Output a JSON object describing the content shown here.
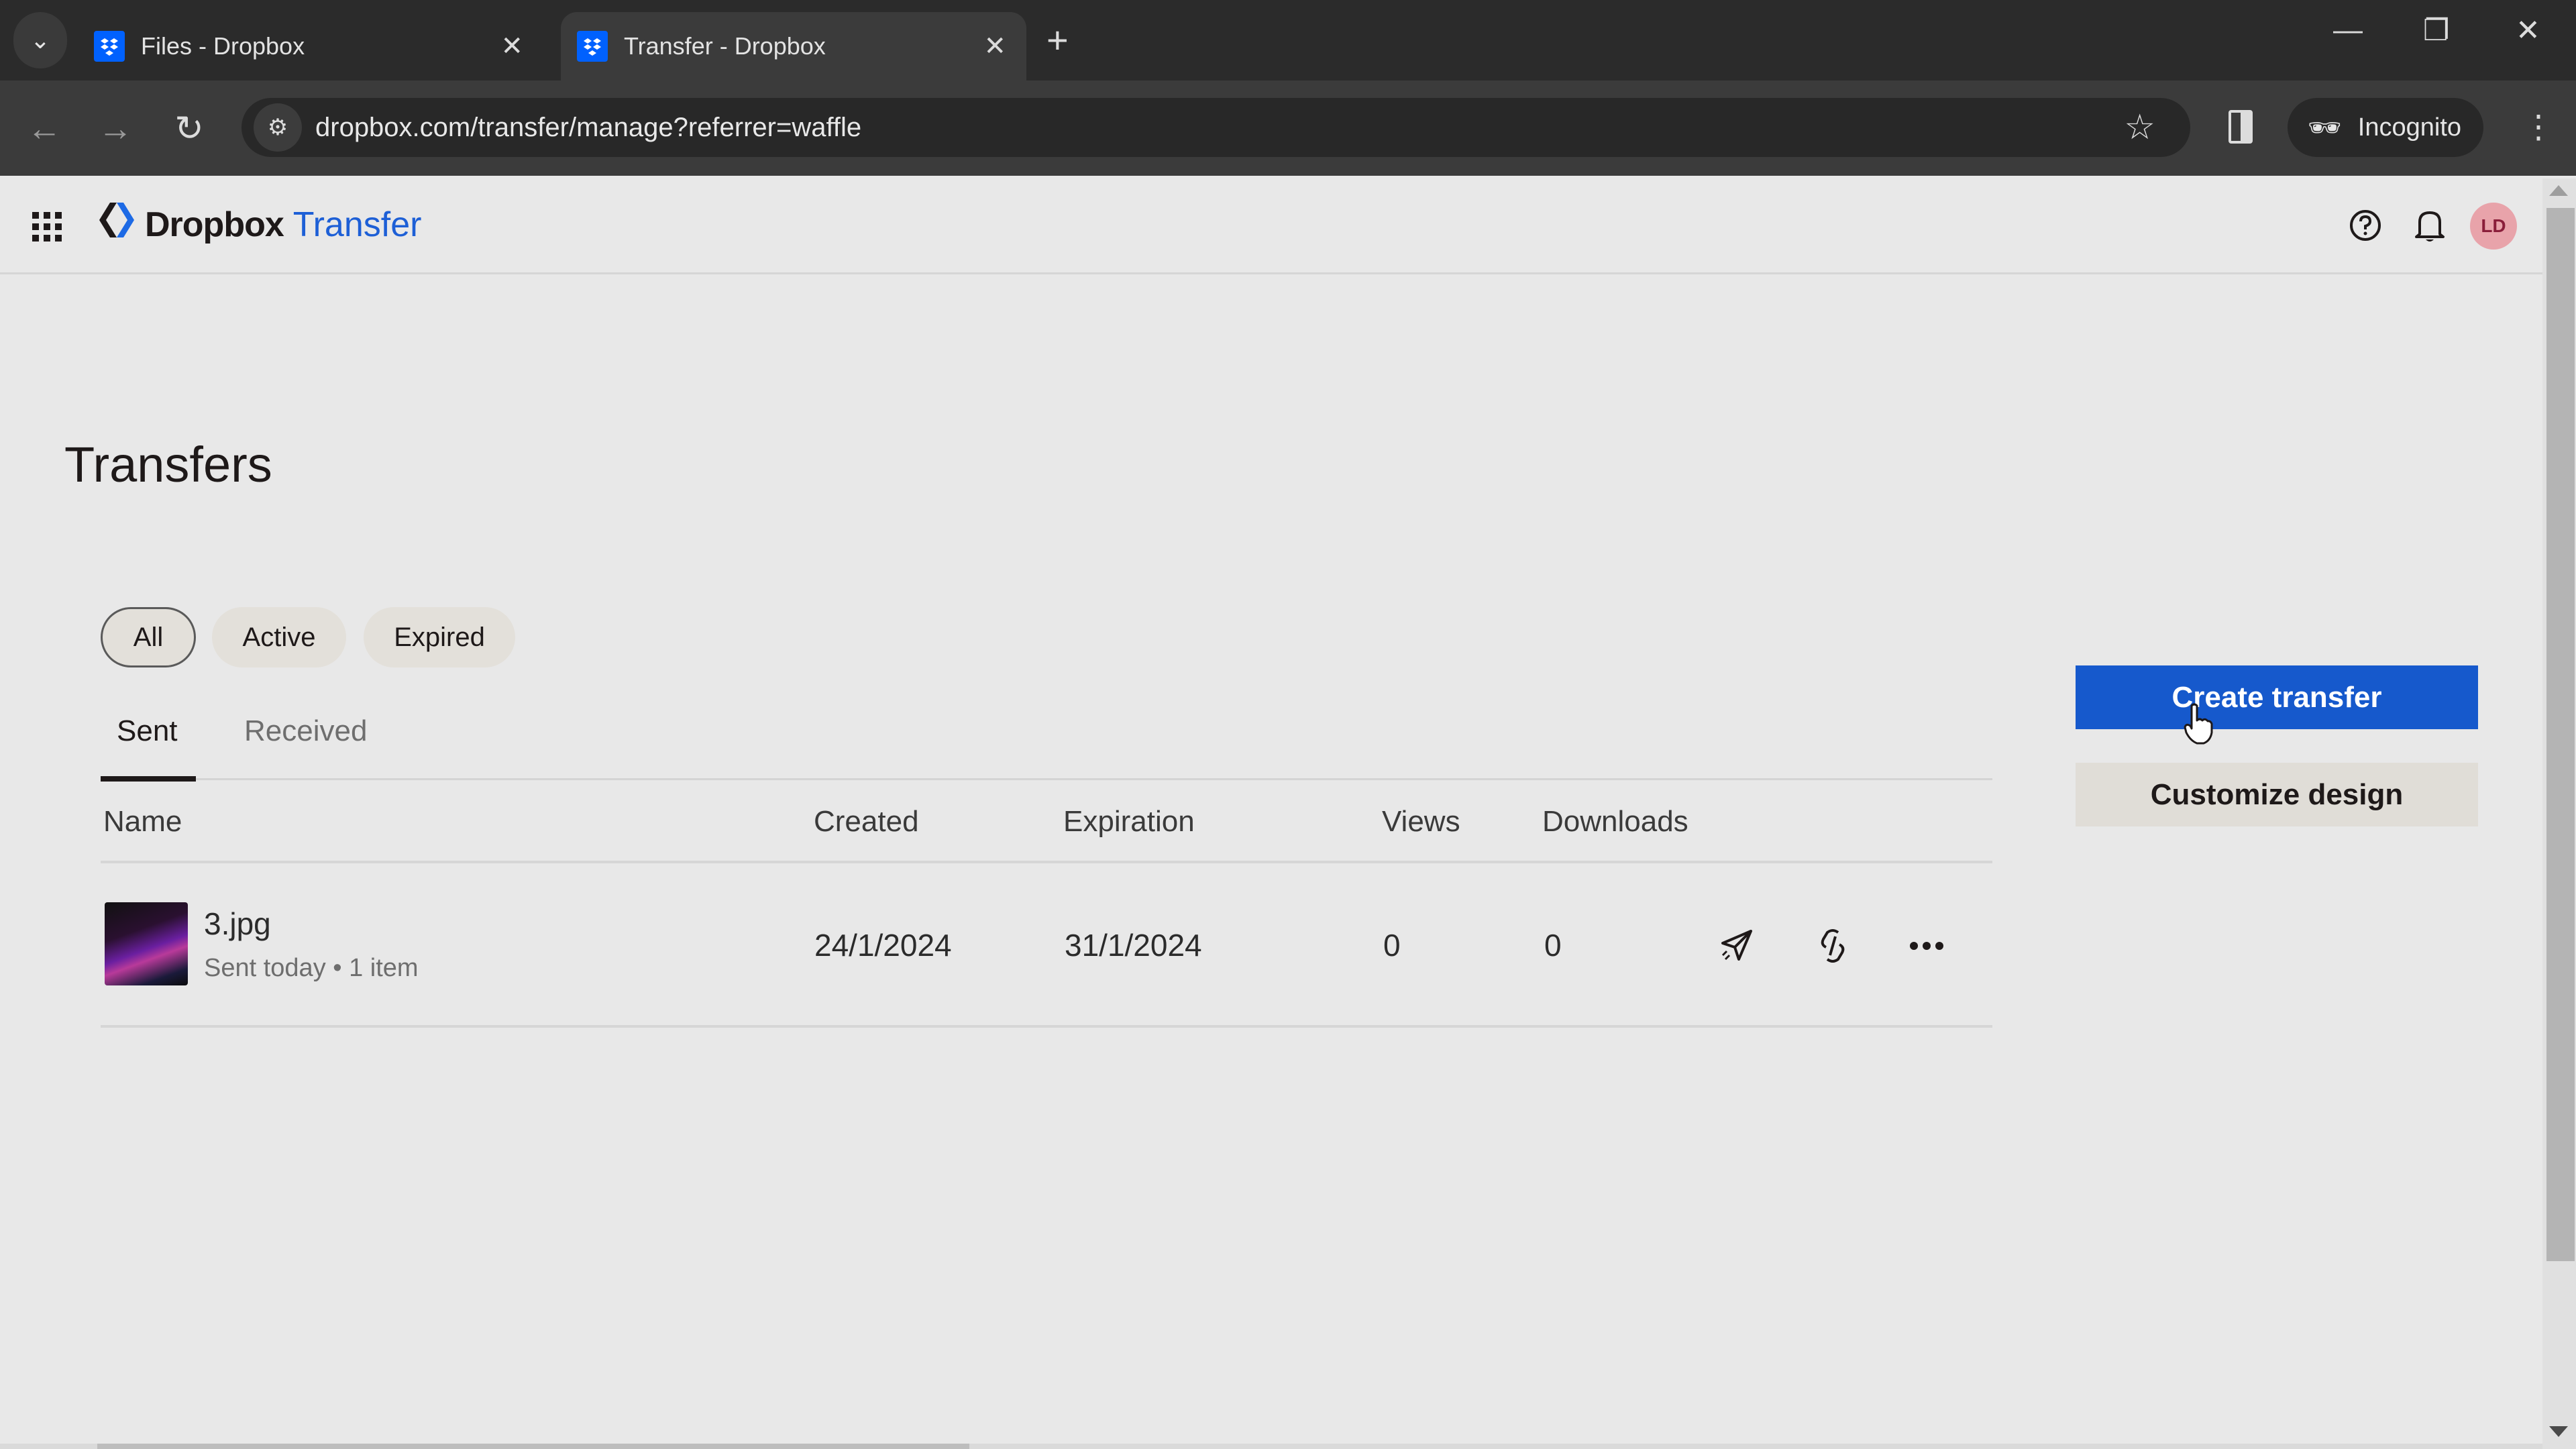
{
  "browser": {
    "tabs": [
      {
        "title": "Files - Dropbox",
        "active": false
      },
      {
        "title": "Transfer - Dropbox",
        "active": true
      }
    ],
    "url": "dropbox.com/transfer/manage?referrer=waffle",
    "incognito_label": "Incognito",
    "icons": {
      "tab_search": "chevron-down-icon",
      "new_tab": "plus-icon",
      "back": "arrow-left-icon",
      "forward": "arrow-right-icon",
      "reload": "reload-icon",
      "site_info": "tune-icon",
      "bookmark": "star-icon",
      "side_panel": "side-panel-icon",
      "menu": "kebab-icon"
    }
  },
  "header": {
    "brand_primary": "Dropbox",
    "brand_secondary": "Transfer",
    "avatar_initials": "LD",
    "icons": {
      "apps": "grid-icon",
      "help": "help-icon",
      "notifications": "bell-icon"
    }
  },
  "main": {
    "title": "Transfers",
    "filters": [
      {
        "label": "All",
        "selected": true
      },
      {
        "label": "Active",
        "selected": false
      },
      {
        "label": "Expired",
        "selected": false
      }
    ],
    "tabs": [
      {
        "label": "Sent",
        "active": true
      },
      {
        "label": "Received",
        "active": false
      }
    ],
    "table": {
      "columns": [
        "Name",
        "Created",
        "Expiration",
        "Views",
        "Downloads"
      ],
      "rows": [
        {
          "name": "3.jpg",
          "subtitle": "Sent today • 1 item",
          "created": "24/1/2024",
          "expiration": "31/1/2024",
          "views": "0",
          "downloads": "0",
          "actions": [
            "send-icon",
            "link-icon",
            "more-icon"
          ]
        }
      ]
    }
  },
  "actions": {
    "create_transfer": "Create transfer",
    "customize_design": "Customize design"
  },
  "colors": {
    "accent": "#1659cc",
    "brand_blue": "#0061fe",
    "avatar_bg": "#e8a3aa"
  }
}
